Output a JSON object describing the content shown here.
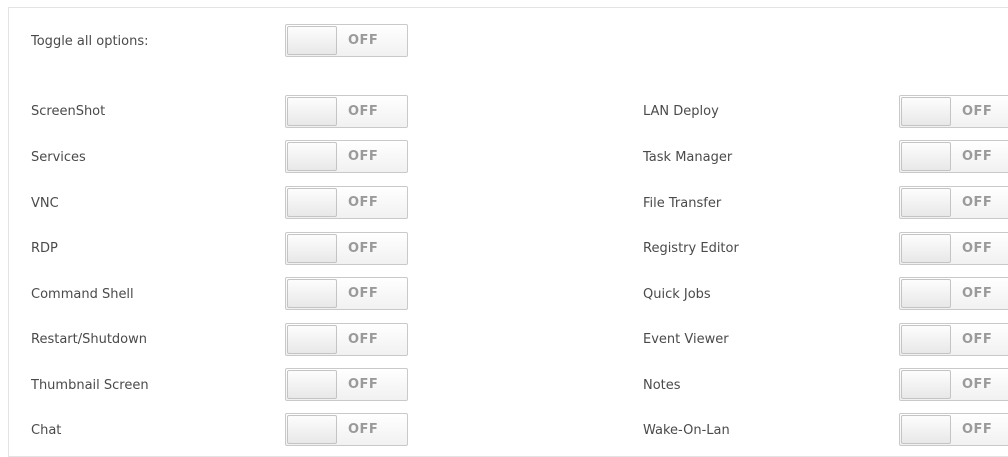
{
  "toggle_all": {
    "label": "Toggle all options:",
    "state": "OFF"
  },
  "left_options": [
    {
      "label": "ScreenShot",
      "state": "OFF"
    },
    {
      "label": "Services",
      "state": "OFF"
    },
    {
      "label": "VNC",
      "state": "OFF"
    },
    {
      "label": "RDP",
      "state": "OFF"
    },
    {
      "label": "Command Shell",
      "state": "OFF"
    },
    {
      "label": "Restart/Shutdown",
      "state": "OFF"
    },
    {
      "label": "Thumbnail Screen",
      "state": "OFF"
    },
    {
      "label": "Chat",
      "state": "OFF"
    }
  ],
  "right_options": [
    {
      "label": "LAN Deploy",
      "state": "OFF"
    },
    {
      "label": "Task Manager",
      "state": "OFF"
    },
    {
      "label": "File Transfer",
      "state": "OFF"
    },
    {
      "label": "Registry Editor",
      "state": "OFF"
    },
    {
      "label": "Quick Jobs",
      "state": "OFF"
    },
    {
      "label": "Event Viewer",
      "state": "OFF"
    },
    {
      "label": "Notes",
      "state": "OFF"
    },
    {
      "label": "Wake-On-Lan",
      "state": "OFF"
    }
  ]
}
